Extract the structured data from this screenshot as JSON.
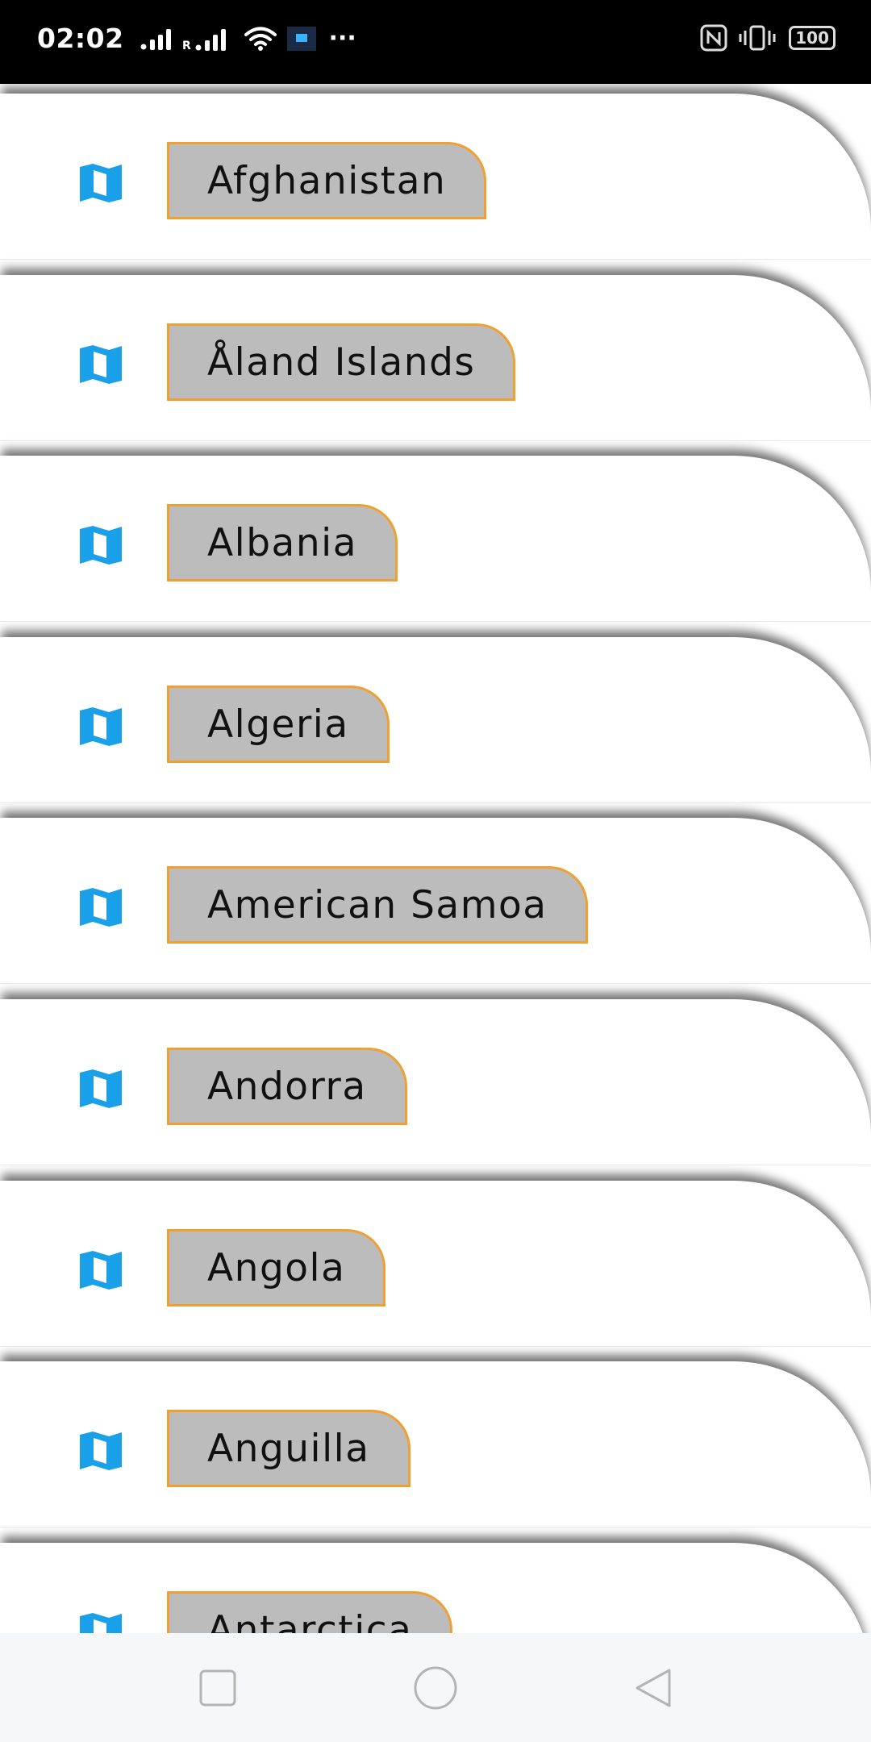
{
  "status_bar": {
    "time": "02:02",
    "roaming_indicator": "R",
    "battery_level": "100",
    "icons": [
      "signal-icon",
      "wifi-icon",
      "app-notification-icon",
      "more-icon",
      "nfc-icon",
      "vibrate-icon",
      "battery-icon"
    ]
  },
  "list": {
    "item_icon": "map-icon",
    "items": [
      {
        "name": "Afghanistan"
      },
      {
        "name": "Åland Islands"
      },
      {
        "name": "Albania"
      },
      {
        "name": "Algeria"
      },
      {
        "name": "American Samoa"
      },
      {
        "name": "Andorra"
      },
      {
        "name": "Angola"
      },
      {
        "name": "Anguilla"
      },
      {
        "name": "Antarctica"
      }
    ]
  },
  "nav_bar": {
    "buttons": [
      "recent-apps-button",
      "home-button",
      "back-button"
    ]
  },
  "colors": {
    "icon_blue": "#1aa0e8",
    "pill_fill": "#bcbcbc",
    "pill_border": "#f0a030",
    "status_bar_bg": "#000000",
    "nav_bar_bg": "#f6f7f9"
  }
}
